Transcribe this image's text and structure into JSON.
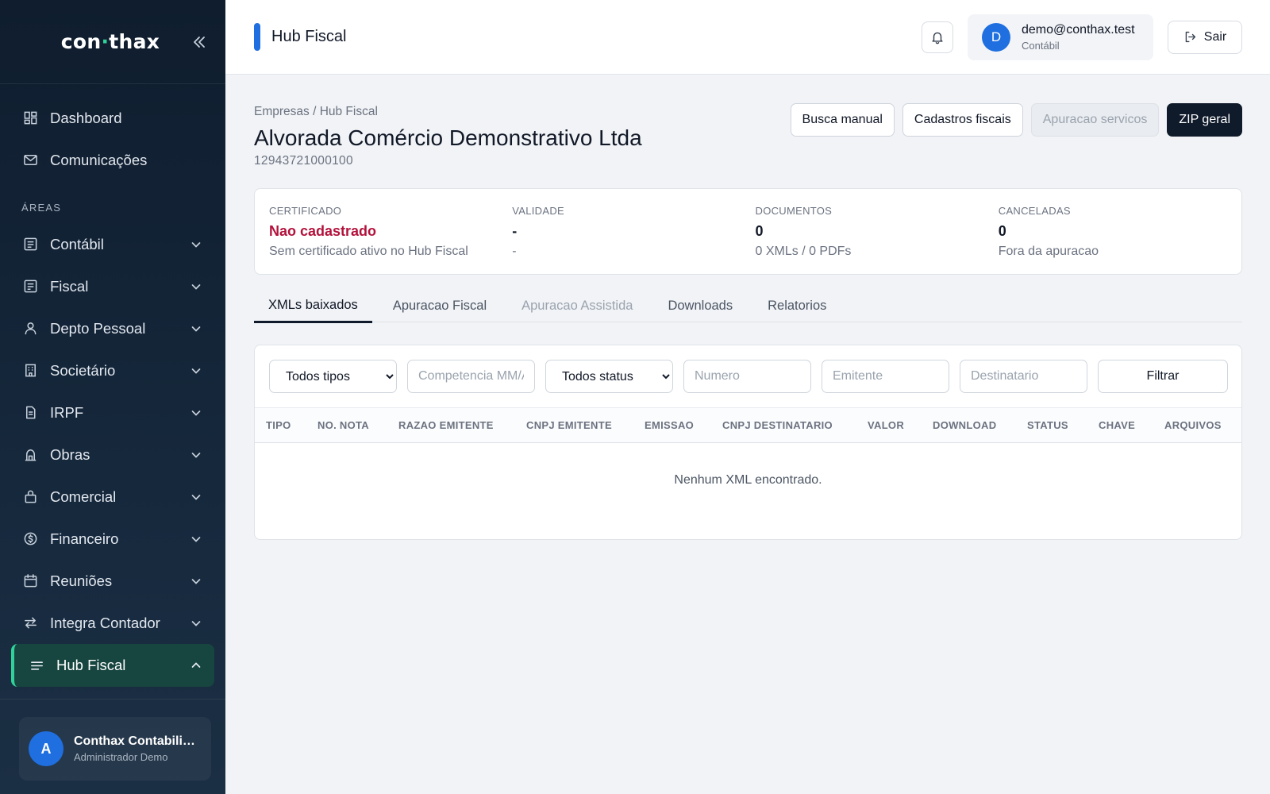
{
  "brand": {
    "prefix": "con",
    "dot": "·",
    "suffix": "thax"
  },
  "sidebar": {
    "top_items": [
      {
        "label": "Dashboard",
        "icon": "dashboard-icon"
      },
      {
        "label": "Comunicações",
        "icon": "mail-icon"
      }
    ],
    "section_label": "ÁREAS",
    "areas": [
      {
        "label": "Contábil",
        "icon": "ledger-icon"
      },
      {
        "label": "Fiscal",
        "icon": "receipt-icon"
      },
      {
        "label": "Depto Pessoal",
        "icon": "person-icon"
      },
      {
        "label": "Societário",
        "icon": "building-icon"
      },
      {
        "label": "IRPF",
        "icon": "document-icon"
      },
      {
        "label": "Obras",
        "icon": "construction-icon"
      },
      {
        "label": "Comercial",
        "icon": "shop-icon"
      },
      {
        "label": "Financeiro",
        "icon": "money-icon"
      },
      {
        "label": "Reuniões",
        "icon": "calendar-icon"
      },
      {
        "label": "Integra Contador",
        "icon": "sync-icon"
      }
    ],
    "active_item": {
      "label": "Hub Fiscal",
      "icon": "list-icon"
    },
    "user": {
      "initial": "A",
      "name": "Conthax Contabilidade",
      "role": "Administrador Demo"
    }
  },
  "header": {
    "title": "Hub Fiscal",
    "account": {
      "initial": "D",
      "email": "demo@conthax.test",
      "role": "Contábil"
    },
    "logout_label": "Sair"
  },
  "page": {
    "breadcrumb": "Empresas / Hub Fiscal",
    "company_name": "Alvorada Comércio Demonstrativo Ltda",
    "company_cnpj": "12943721000100",
    "actions": {
      "manual_search": "Busca manual",
      "fiscal_records": "Cadastros fiscais",
      "service_calc": "Apuracao servicos",
      "zip_all": "ZIP geral"
    }
  },
  "stats": [
    {
      "label": "CERTIFICADO",
      "value": "Nao cadastrado",
      "sub": "Sem certificado ativo no Hub Fiscal",
      "tone": "danger"
    },
    {
      "label": "VALIDADE",
      "value": "-",
      "sub": "-",
      "tone": "normal"
    },
    {
      "label": "DOCUMENTOS",
      "value": "0",
      "sub": "0 XMLs / 0 PDFs",
      "tone": "normal"
    },
    {
      "label": "CANCELADAS",
      "value": "0",
      "sub": "Fora da apuracao",
      "tone": "normal"
    }
  ],
  "tabs": [
    {
      "label": "XMLs baixados",
      "state": "active"
    },
    {
      "label": "Apuracao Fiscal",
      "state": "normal"
    },
    {
      "label": "Apuracao Assistida",
      "state": "muted"
    },
    {
      "label": "Downloads",
      "state": "normal"
    },
    {
      "label": "Relatorios",
      "state": "normal"
    }
  ],
  "filters": {
    "type_selected": "Todos tipos",
    "competence_placeholder": "Competencia MM/AAAA",
    "status_selected": "Todos status",
    "number_placeholder": "Numero",
    "issuer_placeholder": "Emitente",
    "recipient_placeholder": "Destinatario",
    "filter_button": "Filtrar"
  },
  "table": {
    "columns": [
      "TIPO",
      "NO. NOTA",
      "RAZAO EMITENTE",
      "CNPJ EMITENTE",
      "EMISSAO",
      "CNPJ DESTINATARIO",
      "VALOR",
      "DOWNLOAD",
      "STATUS",
      "CHAVE",
      "ARQUIVOS"
    ],
    "empty_message": "Nenhum XML encontrado."
  },
  "colors": {
    "accent": "#1f6fe0",
    "active_green": "#2fd39a",
    "danger": "#b3123b",
    "dark_button": "#0f1a2a"
  }
}
